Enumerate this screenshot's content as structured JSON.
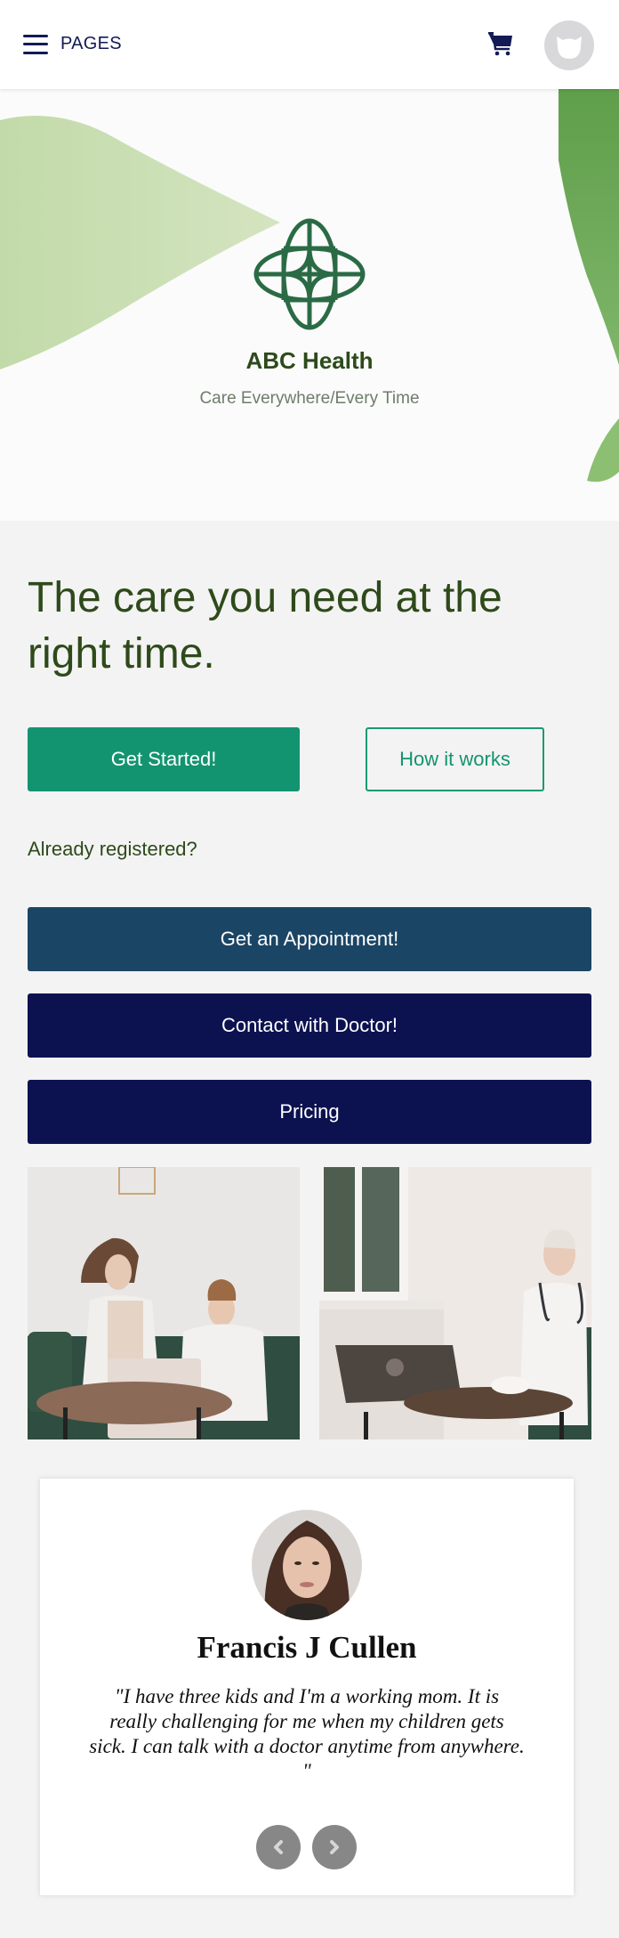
{
  "header": {
    "menu_label": "PAGES",
    "icons": {
      "menu": "hamburger-icon",
      "cart": "shopping-cart-icon",
      "avatar": "user-avatar-placeholder"
    }
  },
  "hero": {
    "brand_name": "ABC Health",
    "tagline": "Care Everywhere/Every Time",
    "logo_icon": "medical-cross-flower-logo"
  },
  "main": {
    "headline": "The care you need at the right time.",
    "get_started_label": "Get Started!",
    "how_it_works_label": "How it works",
    "already_registered": "Already registered?",
    "appointment_label": "Get an Appointment!",
    "contact_label": "Contact with Doctor!",
    "pricing_label": "Pricing"
  },
  "photos": [
    {
      "alt": "Mother and child on video call with doctor"
    },
    {
      "alt": "Doctor on video call at laptop"
    }
  ],
  "testimonial": {
    "name": "Francis J Cullen",
    "quote": "\"I have three kids and I'm a working mom. It is really challenging for me when my children gets sick. I can talk with a doctor anytime from anywhere. \"",
    "prev_icon": "chevron-left-icon",
    "next_icon": "chevron-right-icon"
  },
  "colors": {
    "brand_green": "#2d5f3f",
    "primary_button": "#139470",
    "appointment_button": "#1b4565",
    "navy_button": "#0c1250",
    "headline_text": "#2e4a1a",
    "nav_text": "#131a55"
  }
}
